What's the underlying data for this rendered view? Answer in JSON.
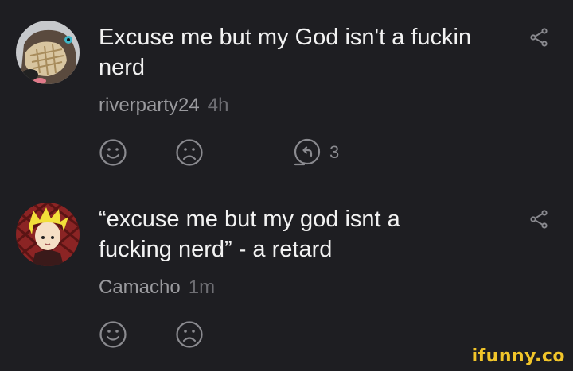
{
  "comments": [
    {
      "text": "Excuse me but my God isn't a fuckin nerd",
      "username": "riverparty24",
      "time": "4h",
      "reply_count": "3",
      "avatar_icon": "dog-avatar"
    },
    {
      "text": "“excuse me but my god isnt a fucking nerd” - a retard",
      "username": "Camacho",
      "time": "1m",
      "avatar_icon": "anime-character-avatar"
    }
  ],
  "watermark": "ifunny.co",
  "colors": {
    "background": "#1e1e22",
    "text": "#f2f2f2",
    "username": "#9a9a9e",
    "time": "#6e6e73",
    "icon": "#8a8a8f",
    "watermark": "#f1c52a"
  }
}
